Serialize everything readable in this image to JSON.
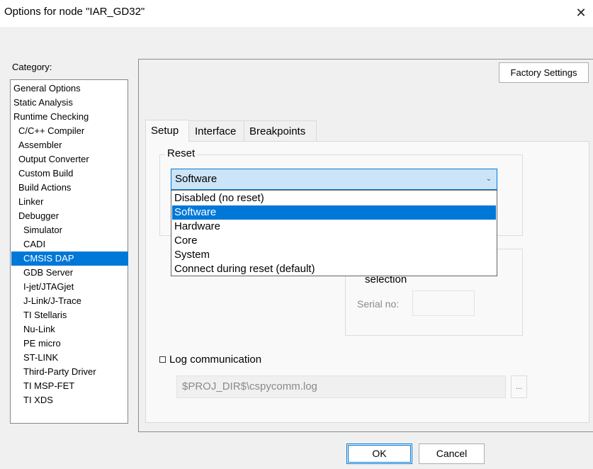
{
  "window": {
    "title": "Options for node \"IAR_GD32\"",
    "close_glyph": "✕"
  },
  "category": {
    "label": "Category:",
    "items": [
      {
        "label": "General Options",
        "indent": 0
      },
      {
        "label": "Static Analysis",
        "indent": 0
      },
      {
        "label": "Runtime Checking",
        "indent": 0
      },
      {
        "label": "C/C++ Compiler",
        "indent": 1
      },
      {
        "label": "Assembler",
        "indent": 1
      },
      {
        "label": "Output Converter",
        "indent": 1
      },
      {
        "label": "Custom Build",
        "indent": 1
      },
      {
        "label": "Build Actions",
        "indent": 1
      },
      {
        "label": "Linker",
        "indent": 1
      },
      {
        "label": "Debugger",
        "indent": 1
      },
      {
        "label": "Simulator",
        "indent": 2
      },
      {
        "label": "CADI",
        "indent": 2
      },
      {
        "label": "CMSIS DAP",
        "indent": 2,
        "selected": true
      },
      {
        "label": "GDB Server",
        "indent": 2
      },
      {
        "label": "I-jet/JTAGjet",
        "indent": 2
      },
      {
        "label": "J-Link/J-Trace",
        "indent": 2
      },
      {
        "label": "TI Stellaris",
        "indent": 2
      },
      {
        "label": "Nu-Link",
        "indent": 2
      },
      {
        "label": "PE micro",
        "indent": 2
      },
      {
        "label": "ST-LINK",
        "indent": 2
      },
      {
        "label": "Third-Party Driver",
        "indent": 2
      },
      {
        "label": "TI MSP-FET",
        "indent": 2
      },
      {
        "label": "TI XDS",
        "indent": 2
      }
    ]
  },
  "factory_settings_label": "Factory Settings",
  "tabs": [
    {
      "label": "Setup",
      "active": true
    },
    {
      "label": "Interface"
    },
    {
      "label": "Breakpoints"
    }
  ],
  "reset": {
    "group_label": "Reset",
    "selected": "Software",
    "options": [
      {
        "label": "Disabled (no reset)"
      },
      {
        "label": "Software",
        "selected": true
      },
      {
        "label": "Hardware"
      },
      {
        "label": "Core"
      },
      {
        "label": "System"
      },
      {
        "label": "Connect during reset (default)"
      }
    ]
  },
  "probe": {
    "selection_text": "selection",
    "serial_label": "Serial no:",
    "serial_value": ""
  },
  "log": {
    "label": "Log communication",
    "checked": false,
    "path": "$PROJ_DIR$\\cspycomm.log",
    "browse_label": "..."
  },
  "buttons": {
    "ok": "OK",
    "cancel": "Cancel"
  },
  "colors": {
    "selection": "#0078d7",
    "select_bg": "#cce4f7"
  }
}
